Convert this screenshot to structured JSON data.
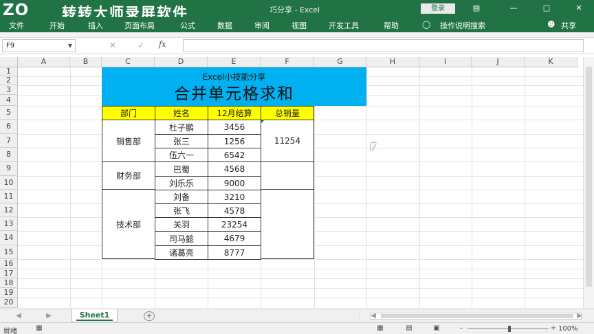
{
  "titlebar": {
    "watermark_logo": "ZO",
    "watermark_text": "转转大师录屏软件",
    "doc_title": "巧分享 - Excel",
    "login_label": "登录",
    "icons": [
      "ribbon-display-icon",
      "minimize-icon",
      "restore-icon",
      "close-icon"
    ]
  },
  "ribbon": {
    "tabs": [
      "文件",
      "开始",
      "插入",
      "页面布局",
      "公式",
      "数据",
      "审阅",
      "视图",
      "开发工具",
      "帮助"
    ],
    "tell_me": "操作说明搜索",
    "share": "共享"
  },
  "formula_bar": {
    "name_box": "F9",
    "fx": "fx",
    "value": ""
  },
  "columns": [
    "A",
    "B",
    "C",
    "D",
    "E",
    "F",
    "G",
    "H",
    "I",
    "J",
    "K"
  ],
  "rows": [
    "1",
    "2",
    "3",
    "4",
    "5",
    "6",
    "7",
    "8",
    "9",
    "10",
    "11",
    "12",
    "13",
    "14",
    "15",
    "16",
    "17",
    "18",
    "19",
    "20"
  ],
  "sheet": {
    "banner_subtitle": "Excel小技能分享",
    "banner_title": "合并单元格求和",
    "headers": [
      "部门",
      "姓名",
      "12月结算",
      "总销量"
    ],
    "departments": [
      "销售部",
      "财务部",
      "技术部"
    ],
    "names": [
      "杜子鹏",
      "张三",
      "伍六一",
      "巴蜀",
      "刘乐乐",
      "刘备",
      "张飞",
      "关羽",
      "司马懿",
      "诸葛亮"
    ],
    "values": [
      "3456",
      "1256",
      "6542",
      "4568",
      "9000",
      "3210",
      "4578",
      "23254",
      "4679",
      "8777"
    ],
    "total_sales": "11254"
  },
  "tabs_bar": {
    "sheet_name": "Sheet1",
    "add_icon": "plus-circle-icon"
  },
  "status": {
    "text": "就绪",
    "zoom": "100%"
  },
  "colors": {
    "excel_green": "#217346",
    "banner_blue": "#00b0f0",
    "header_yellow": "#ffff00"
  }
}
